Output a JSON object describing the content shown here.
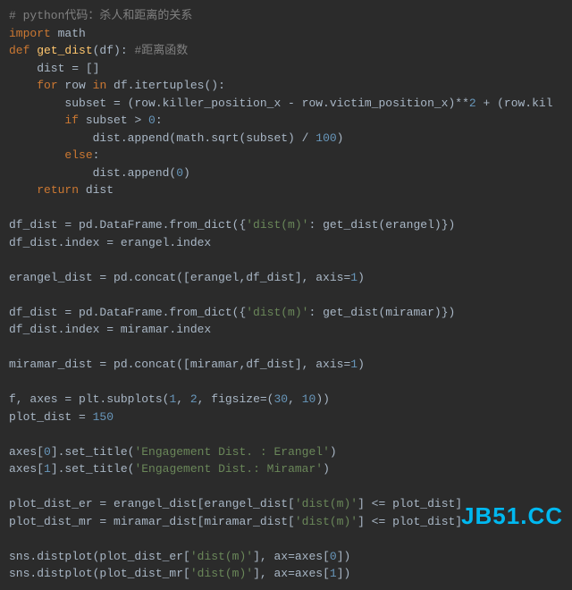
{
  "code": {
    "l1_comment": "# python代码：杀人和距离的关系",
    "l2_kw1": "import",
    "l2_mod": " math",
    "l3_kw1": "def",
    "l3_fn": " get_dist",
    "l3_paren": "(df): ",
    "l3_comment": "#距离函数",
    "l4": "    dist = []",
    "l5_pre": "    ",
    "l5_kw1": "for",
    "l5_mid": " row ",
    "l5_kw2": "in",
    "l5_tail": " df.itertuples():",
    "l6_pre": "        subset = (row.killer_position_x - row.victim_position_x)**",
    "l6_n1": "2",
    "l6_mid": " + (row.kil",
    "l7_pre": "        ",
    "l7_kw": "if",
    "l7_mid": " subset > ",
    "l7_n": "0",
    "l7_tail": ":",
    "l8_pre": "            dist.append(math.sqrt(subset) / ",
    "l8_n": "100",
    "l8_tail": ")",
    "l9_pre": "        ",
    "l9_kw": "else",
    "l9_tail": ":",
    "l10_pre": "            dist.append(",
    "l10_n": "0",
    "l10_tail": ")",
    "l11_pre": "    ",
    "l11_kw": "return",
    "l11_tail": " dist",
    "blank": "",
    "l13_pre": "df_dist = pd.DataFrame.from_dict({",
    "l13_s": "'dist(m)'",
    "l13_tail": ": get_dist(erangel)})",
    "l14": "df_dist.index = erangel.index",
    "l16_pre": "erangel_dist = pd.concat([erangel,df_dist], axis=",
    "l16_n": "1",
    "l16_tail": ")",
    "l18_pre": "df_dist = pd.DataFrame.from_dict({",
    "l18_s": "'dist(m)'",
    "l18_tail": ": get_dist(miramar)})",
    "l19": "df_dist.index = miramar.index",
    "l21_pre": "miramar_dist = pd.concat([miramar,df_dist], axis=",
    "l21_n": "1",
    "l21_tail": ")",
    "l23_pre": "f, axes = plt.subplots(",
    "l23_n1": "1",
    "l23_c1": ", ",
    "l23_n2": "2",
    "l23_c2": ", figsize=(",
    "l23_n3": "30",
    "l23_c3": ", ",
    "l23_n4": "10",
    "l23_tail": "))",
    "l24_pre": "plot_dist = ",
    "l24_n": "150",
    "l26_pre": "axes[",
    "l26_n": "0",
    "l26_mid": "].set_title(",
    "l26_s": "'Engagement Dist. : Erangel'",
    "l26_tail": ")",
    "l27_pre": "axes[",
    "l27_n": "1",
    "l27_mid": "].set_title(",
    "l27_s": "'Engagement Dist.: Miramar'",
    "l27_tail": ")",
    "l29_pre": "plot_dist_er = erangel_dist[erangel_dist[",
    "l29_s": "'dist(m)'",
    "l29_tail": "] <= plot_dist]",
    "l30_pre": "plot_dist_mr = miramar_dist[miramar_dist[",
    "l30_s": "'dist(m)'",
    "l30_tail": "] <= plot_dist]",
    "l32_pre": "sns.distplot(plot_dist_er[",
    "l32_s": "'dist(m)'",
    "l32_mid": "], ax=axes[",
    "l32_n": "0",
    "l32_tail": "])",
    "l33_pre": "sns.distplot(plot_dist_mr[",
    "l33_s": "'dist(m)'",
    "l33_mid": "], ax=axes[",
    "l33_n": "1",
    "l33_tail": "])"
  },
  "watermark": "JB51.CC"
}
